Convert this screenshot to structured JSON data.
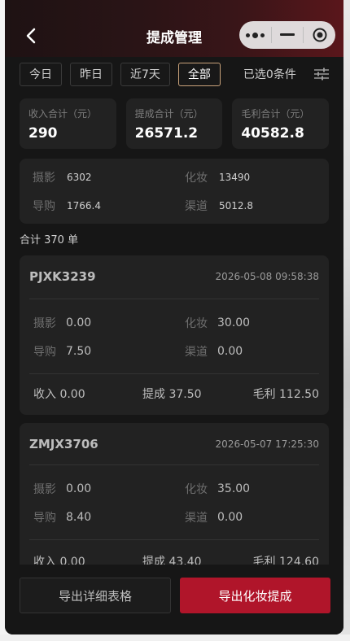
{
  "header": {
    "title": "提成管理",
    "back_icon": "chevron-left-icon",
    "capsule_more_icon": "more-dots-icon",
    "capsule_minimize_icon": "minimize-icon",
    "capsule_close_icon": "target-close-icon"
  },
  "filters": {
    "chips": [
      {
        "label": "今日",
        "active": false
      },
      {
        "label": "昨日",
        "active": false
      },
      {
        "label": "近7天",
        "active": false
      },
      {
        "label": "全部",
        "active": true
      }
    ],
    "selected_text": "已选0条件",
    "filter_icon": "sliders-icon"
  },
  "summary": [
    {
      "label": "收入合计（元）",
      "value": "290"
    },
    {
      "label": "提成合计（元）",
      "value": "26571.2"
    },
    {
      "label": "毛利合计（元）",
      "value": "40582.8"
    }
  ],
  "breakdown": [
    {
      "label": "摄影",
      "value": "6302"
    },
    {
      "label": "化妆",
      "value": "13490"
    },
    {
      "label": "导购",
      "value": "1766.4"
    },
    {
      "label": "渠道",
      "value": "5012.8"
    }
  ],
  "total_text": "合计 370 单",
  "orders": [
    {
      "id": "PJXK3239",
      "time": "2026-05-08 09:58:38",
      "items": [
        {
          "label": "摄影",
          "value": "0.00"
        },
        {
          "label": "化妆",
          "value": "30.00"
        },
        {
          "label": "导购",
          "value": "7.50"
        },
        {
          "label": "渠道",
          "value": "0.00"
        }
      ],
      "income": "收入 0.00",
      "commission": "提成 37.50",
      "profit": "毛利 112.50"
    },
    {
      "id": "ZMJX3706",
      "time": "2026-05-07 17:25:30",
      "items": [
        {
          "label": "摄影",
          "value": "0.00"
        },
        {
          "label": "化妆",
          "value": "35.00"
        },
        {
          "label": "导购",
          "value": "8.40"
        },
        {
          "label": "渠道",
          "value": "0.00"
        }
      ],
      "income": "收入 0.00",
      "commission": "提成 43.40",
      "profit": "毛利 124.60"
    }
  ],
  "buttons": {
    "export_detail": "导出详细表格",
    "export_makeup": "导出化妆提成"
  },
  "colors": {
    "accent": "#b0152a",
    "active_border": "#c9a27a",
    "background": "#161616",
    "card": "#222222"
  }
}
